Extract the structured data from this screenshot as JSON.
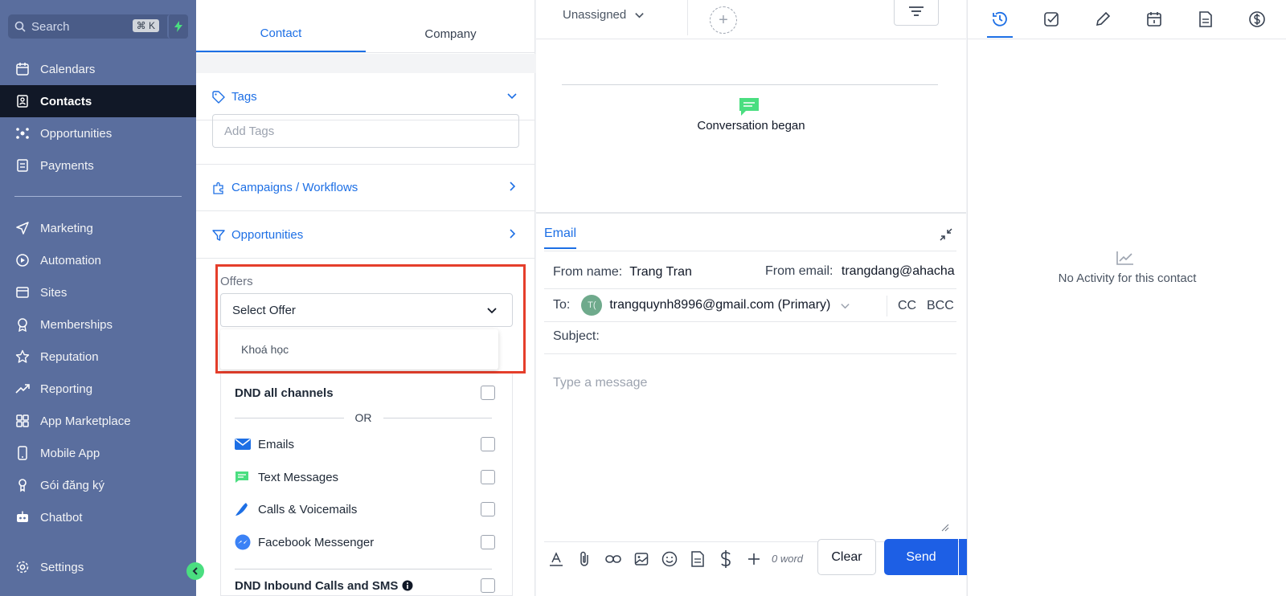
{
  "sidebar": {
    "search": {
      "placeholder": "Search",
      "shortcut": "⌘ K",
      "bolt_icon": "bolt-icon"
    },
    "items": [
      {
        "label": "Calendars",
        "icon": "calendar-icon"
      },
      {
        "label": "Contacts",
        "icon": "contacts-icon",
        "active": true
      },
      {
        "label": "Opportunities",
        "icon": "opportunities-icon"
      },
      {
        "label": "Payments",
        "icon": "payments-icon"
      },
      {
        "label": "Marketing",
        "icon": "send-icon"
      },
      {
        "label": "Automation",
        "icon": "automation-icon"
      },
      {
        "label": "Sites",
        "icon": "sites-icon"
      },
      {
        "label": "Memberships",
        "icon": "badge-icon"
      },
      {
        "label": "Reputation",
        "icon": "star-icon"
      },
      {
        "label": "Reporting",
        "icon": "trend-icon"
      },
      {
        "label": "App Marketplace",
        "icon": "grid-icon"
      },
      {
        "label": "Mobile App",
        "icon": "mobile-icon"
      },
      {
        "label": "Gói đăng ký",
        "icon": "subscription-icon"
      },
      {
        "label": "Chatbot",
        "icon": "robot-icon"
      },
      {
        "label": "Settings",
        "icon": "gear-icon"
      }
    ],
    "colors": {
      "background": "#5a6e9e",
      "active": "#111827",
      "collapse": "#4ade80"
    }
  },
  "contact_panel": {
    "tabs": [
      {
        "label": "Contact",
        "active": true
      },
      {
        "label": "Company",
        "active": false
      }
    ],
    "tags": {
      "label": "Tags",
      "placeholder": "Add Tags"
    },
    "campaigns": {
      "label": "Campaigns / Workflows"
    },
    "opportunities": {
      "label": "Opportunities"
    },
    "offers": {
      "label": "Offers",
      "select_value": "Select Offer",
      "options": [
        "Khoá học"
      ]
    },
    "dnd": {
      "all_channels": "DND all channels",
      "or": "OR",
      "channels": [
        "Emails",
        "Text Messages",
        "Calls & Voicemails",
        "Facebook Messenger"
      ],
      "inbound": "DND Inbound Calls and SMS"
    },
    "highlight_color": "#e53e2b"
  },
  "conversation": {
    "assignee": "Unassigned",
    "began": "Conversation began",
    "email": {
      "tab": "Email",
      "from_name_label": "From name:",
      "from_name": "Trang Tran",
      "from_email_label": "From email:",
      "from_email": "trangdang@ahacha",
      "to_label": "To:",
      "to_avatar": "T(",
      "to_value": "trangquynh8996@gmail.com (Primary)",
      "cc": "CC",
      "bcc": "BCC",
      "subject_label": "Subject:",
      "message_placeholder": "Type a message",
      "word_count": "0 word"
    },
    "buttons": {
      "clear": "Clear",
      "send": "Send"
    },
    "accent": "#1d5fe5"
  },
  "activity": {
    "tabs": [
      "activity-icon",
      "task-icon",
      "note-icon",
      "appointment-icon",
      "document-icon",
      "payment-icon"
    ],
    "empty": "No Activity for this contact"
  }
}
